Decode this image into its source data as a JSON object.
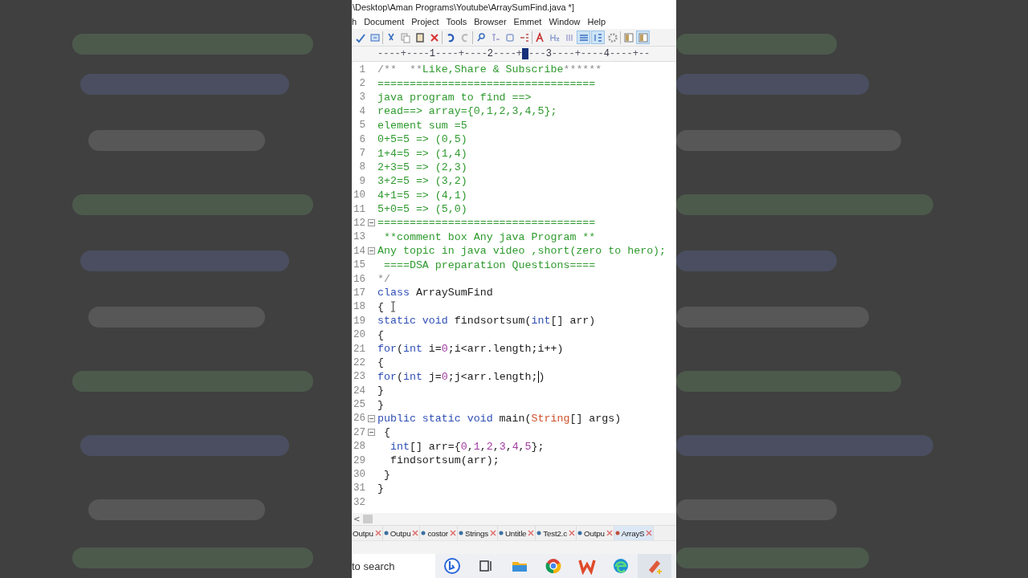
{
  "window": {
    "title": "\\Desktop\\Aman Programs\\Youtube\\ArraySumFind.java *]"
  },
  "menu": [
    {
      "label": "h"
    },
    {
      "label": "Document"
    },
    {
      "label": "Project"
    },
    {
      "label": "Tools"
    },
    {
      "label": "Browser"
    },
    {
      "label": "Emmet"
    },
    {
      "label": "Window"
    },
    {
      "label": "Help"
    }
  ],
  "toolbar": [
    {
      "kind": "spell",
      "pressed": false
    },
    {
      "kind": "preview",
      "pressed": false
    },
    {
      "kind": "sep"
    },
    {
      "kind": "cut",
      "pressed": false
    },
    {
      "kind": "copy",
      "pressed": false
    },
    {
      "kind": "paste",
      "pressed": false
    },
    {
      "kind": "delete",
      "pressed": false
    },
    {
      "kind": "sep"
    },
    {
      "kind": "undo",
      "pressed": false
    },
    {
      "kind": "redo",
      "pressed": false
    },
    {
      "kind": "sep"
    },
    {
      "kind": "find",
      "pressed": false
    },
    {
      "kind": "replace",
      "pressed": false
    },
    {
      "kind": "goto",
      "pressed": false
    },
    {
      "kind": "indent",
      "pressed": false
    },
    {
      "kind": "sep"
    },
    {
      "kind": "font",
      "pressed": false
    },
    {
      "kind": "heading",
      "pressed": false
    },
    {
      "kind": "mark",
      "pressed": false
    },
    {
      "kind": "wrap",
      "pressed": true
    },
    {
      "kind": "numbers",
      "pressed": true
    },
    {
      "kind": "gear",
      "pressed": false
    },
    {
      "kind": "sep"
    },
    {
      "kind": "panel",
      "pressed": false
    },
    {
      "kind": "panel",
      "pressed": true
    }
  ],
  "ruler": {
    "segments": [
      {
        "kind": "dash",
        "text": "----+----"
      },
      {
        "kind": "label",
        "text": "1"
      },
      {
        "kind": "dash",
        "text": "----+----"
      },
      {
        "kind": "label",
        "text": "2"
      },
      {
        "kind": "dash",
        "text": "----+"
      },
      {
        "kind": "marker"
      },
      {
        "kind": "dash",
        "text": "---"
      },
      {
        "kind": "label",
        "text": "3"
      },
      {
        "kind": "dash",
        "text": "----+----"
      },
      {
        "kind": "label",
        "text": "4"
      },
      {
        "kind": "dash",
        "text": "----+--"
      }
    ]
  },
  "code": [
    {
      "number": "1",
      "fold": false,
      "tokens": [
        {
          "kind": "mark",
          "text": "/**  **"
        },
        {
          "kind": "comment",
          "text": "Like,Share & Subscribe"
        },
        {
          "kind": "mark",
          "text": "******"
        }
      ]
    },
    {
      "number": "2",
      "fold": false,
      "tokens": [
        {
          "kind": "comment",
          "text": "=================================="
        }
      ]
    },
    {
      "number": "3",
      "fold": false,
      "tokens": [
        {
          "kind": "comment",
          "text": "java program to find ==>"
        }
      ]
    },
    {
      "number": "4",
      "fold": false,
      "tokens": [
        {
          "kind": "comment",
          "text": "read==> array={0,1,2,3,4,5};"
        }
      ]
    },
    {
      "number": "5",
      "fold": false,
      "tokens": [
        {
          "kind": "comment",
          "text": "element sum =5"
        }
      ]
    },
    {
      "number": "6",
      "fold": false,
      "tokens": [
        {
          "kind": "comment",
          "text": "0+5=5 => (0,5)"
        }
      ]
    },
    {
      "number": "7",
      "fold": false,
      "tokens": [
        {
          "kind": "comment",
          "text": "1+4=5 => (1,4)"
        }
      ]
    },
    {
      "number": "8",
      "fold": false,
      "tokens": [
        {
          "kind": "comment",
          "text": "2+3=5 => (2,3)"
        }
      ]
    },
    {
      "number": "9",
      "fold": false,
      "tokens": [
        {
          "kind": "comment",
          "text": "3+2=5 => (3,2)"
        }
      ]
    },
    {
      "number": "10",
      "fold": false,
      "tokens": [
        {
          "kind": "comment",
          "text": "4+1=5 => (4,1)"
        }
      ]
    },
    {
      "number": "11",
      "fold": false,
      "tokens": [
        {
          "kind": "comment",
          "text": "5+0=5 => (5,0)"
        }
      ]
    },
    {
      "number": "12",
      "fold": true,
      "tokens": [
        {
          "kind": "comment",
          "text": "=================================="
        }
      ]
    },
    {
      "number": "13",
      "fold": false,
      "tokens": [
        {
          "kind": "comment",
          "text": " **comment box Any java Program **"
        }
      ]
    },
    {
      "number": "14",
      "fold": true,
      "tokens": [
        {
          "kind": "comment",
          "text": "Any topic in java video ,short(zero to hero);"
        }
      ]
    },
    {
      "number": "15",
      "fold": false,
      "tokens": [
        {
          "kind": "comment",
          "text": " ====DSA preparation Questions===="
        }
      ]
    },
    {
      "number": "16",
      "fold": false,
      "tokens": [
        {
          "kind": "mark",
          "text": "*/"
        }
      ]
    },
    {
      "number": "17",
      "fold": false,
      "tokens": [
        {
          "kind": "keyword",
          "text": "class"
        },
        {
          "kind": "plain",
          "text": " ArraySumFind"
        }
      ]
    },
    {
      "number": "18",
      "fold": false,
      "tokens": [
        {
          "kind": "plain",
          "text": "{ "
        },
        {
          "kind": "pointer"
        }
      ]
    },
    {
      "number": "19",
      "fold": false,
      "tokens": [
        {
          "kind": "keyword",
          "text": "static void"
        },
        {
          "kind": "plain",
          "text": " findsortsum("
        },
        {
          "kind": "keyword",
          "text": "int"
        },
        {
          "kind": "plain",
          "text": "[] arr)"
        }
      ]
    },
    {
      "number": "20",
      "fold": false,
      "tokens": [
        {
          "kind": "plain",
          "text": "{"
        }
      ]
    },
    {
      "number": "21",
      "fold": false,
      "tokens": [
        {
          "kind": "keyword",
          "text": "for"
        },
        {
          "kind": "plain",
          "text": "("
        },
        {
          "kind": "keyword",
          "text": "int"
        },
        {
          "kind": "plain",
          "text": " i="
        },
        {
          "kind": "number",
          "text": "0"
        },
        {
          "kind": "plain",
          "text": ";i<arr.length;i++)"
        }
      ]
    },
    {
      "number": "22",
      "fold": false,
      "tokens": [
        {
          "kind": "plain",
          "text": "{"
        }
      ]
    },
    {
      "number": "23",
      "fold": false,
      "tokens": [
        {
          "kind": "keyword",
          "text": "for"
        },
        {
          "kind": "plain",
          "text": "("
        },
        {
          "kind": "keyword",
          "text": "int"
        },
        {
          "kind": "plain",
          "text": " j="
        },
        {
          "kind": "number",
          "text": "0"
        },
        {
          "kind": "plain",
          "text": ";j<arr.length;"
        },
        {
          "kind": "caret"
        },
        {
          "kind": "plain",
          "text": ")"
        }
      ]
    },
    {
      "number": "24",
      "fold": false,
      "tokens": [
        {
          "kind": "plain",
          "text": "}"
        }
      ]
    },
    {
      "number": "25",
      "fold": false,
      "tokens": [
        {
          "kind": "plain",
          "text": "}"
        }
      ]
    },
    {
      "number": "26",
      "fold": true,
      "tokens": [
        {
          "kind": "keyword",
          "text": "public static void"
        },
        {
          "kind": "plain",
          "text": " main("
        },
        {
          "kind": "type",
          "text": "String"
        },
        {
          "kind": "plain",
          "text": "[] args)"
        }
      ]
    },
    {
      "number": "27",
      "fold": true,
      "tokens": [
        {
          "kind": "plain",
          "text": " {"
        }
      ]
    },
    {
      "number": "28",
      "fold": false,
      "tokens": [
        {
          "kind": "keyword",
          "text": "  int"
        },
        {
          "kind": "plain",
          "text": "[] arr={"
        },
        {
          "kind": "number",
          "text": "0"
        },
        {
          "kind": "plain",
          "text": ","
        },
        {
          "kind": "number",
          "text": "1"
        },
        {
          "kind": "plain",
          "text": ","
        },
        {
          "kind": "number",
          "text": "2"
        },
        {
          "kind": "plain",
          "text": ","
        },
        {
          "kind": "number",
          "text": "3"
        },
        {
          "kind": "plain",
          "text": ","
        },
        {
          "kind": "number",
          "text": "4"
        },
        {
          "kind": "plain",
          "text": ","
        },
        {
          "kind": "number",
          "text": "5"
        },
        {
          "kind": "plain",
          "text": "};"
        }
      ]
    },
    {
      "number": "29",
      "fold": false,
      "tokens": [
        {
          "kind": "plain",
          "text": "  findsortsum(arr);"
        }
      ]
    },
    {
      "number": "30",
      "fold": false,
      "tokens": [
        {
          "kind": "plain",
          "text": " }"
        }
      ]
    },
    {
      "number": "31",
      "fold": false,
      "tokens": [
        {
          "kind": "plain",
          "text": "}"
        }
      ]
    },
    {
      "number": "32",
      "fold": false
    }
  ],
  "scrollbar": {
    "arrow": "<"
  },
  "tabs": [
    {
      "label": "Outpu",
      "dot": false,
      "selected": false
    },
    {
      "label": "Outpu",
      "dot": true,
      "selected": false
    },
    {
      "label": "costor",
      "dot": true,
      "selected": false
    },
    {
      "label": "Strings",
      "dot": true,
      "selected": false
    },
    {
      "label": "Untitle",
      "dot": true,
      "selected": false
    },
    {
      "label": "Test2.c",
      "dot": true,
      "selected": false
    },
    {
      "label": "Outpu",
      "dot": true,
      "selected": false
    },
    {
      "label": "ArrayS",
      "dot": true,
      "selected": true
    }
  ],
  "taskbar": {
    "search": "to search",
    "apps": [
      {
        "kind": "bing",
        "selected": false
      },
      {
        "kind": "taskview",
        "selected": false
      },
      {
        "kind": "folder",
        "selected": false
      },
      {
        "kind": "chrome",
        "selected": false
      },
      {
        "kind": "wps",
        "selected": false
      },
      {
        "kind": "edge",
        "selected": false
      },
      {
        "kind": "editor",
        "selected": true
      }
    ]
  }
}
